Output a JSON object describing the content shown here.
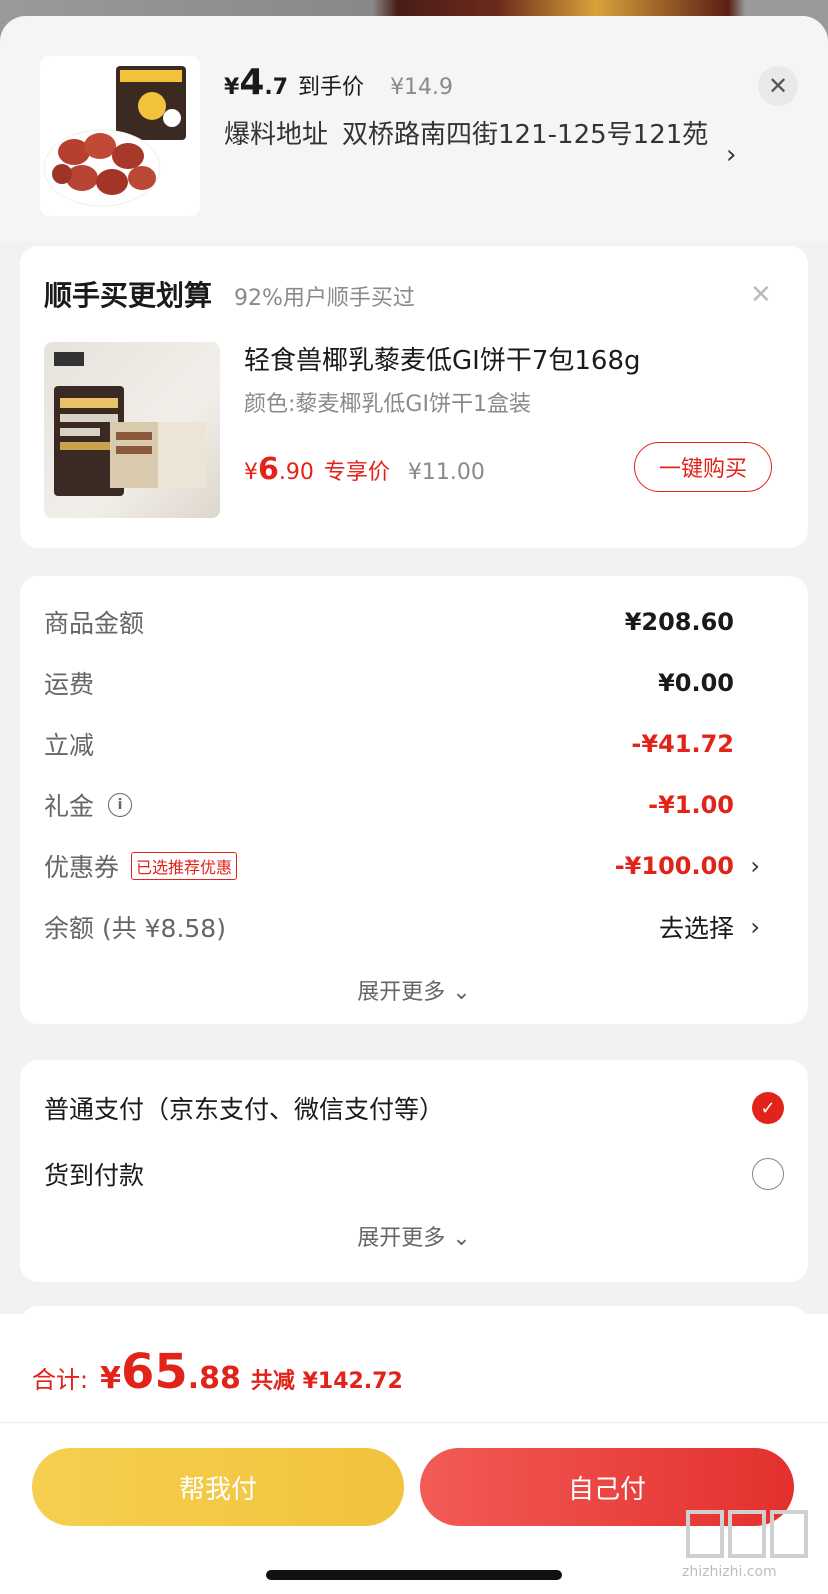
{
  "header": {
    "price_symbol": "¥",
    "price_int": "4",
    "price_dec": ".7",
    "price_tag": "到手价",
    "orig_price": "¥14.9",
    "addr_label": "爆料地址",
    "addr_value": "双桥路南四街121-125号121苑"
  },
  "addon": {
    "title": "顺手买更划算",
    "subtitle": "92%用户顺手买过",
    "product_name": "轻食兽椰乳藜麦低GI饼干7包168g",
    "product_spec": "颜色:藜麦椰乳低GI饼干1盒装",
    "price_symbol": "¥",
    "price_int": "6",
    "price_dec": ".90",
    "price_tag": "专享价",
    "orig_price": "¥11.00",
    "buy_label": "一键购买"
  },
  "summary": {
    "rows": [
      {
        "label": "商品金额",
        "value": "¥208.60"
      },
      {
        "label": "运费",
        "value": "¥0.00"
      },
      {
        "label": "立减",
        "value": "-¥41.72"
      },
      {
        "label": "礼金",
        "value": "-¥1.00"
      },
      {
        "label": "优惠券",
        "value": "-¥100.00",
        "badge": "已选推荐优惠"
      },
      {
        "label": "余额 (共 ¥8.58)",
        "value": "去选择"
      }
    ],
    "expand": "展开更多"
  },
  "payment": {
    "options": [
      {
        "label": "普通支付（京东支付、微信支付等）",
        "selected": true
      },
      {
        "label": "货到付款",
        "selected": false
      }
    ],
    "expand": "展开更多"
  },
  "footer": {
    "total_label": "合计:",
    "total_symbol": "¥",
    "total_int": "65",
    "total_dec": ".88",
    "total_saving": "共减 ¥142.72",
    "help_pay": "帮我付",
    "self_pay": "自己付"
  },
  "colors": {
    "accent": "#e2231a",
    "yellow": "#f3c845"
  },
  "watermark": {
    "text": "zhizhizhi.com"
  }
}
